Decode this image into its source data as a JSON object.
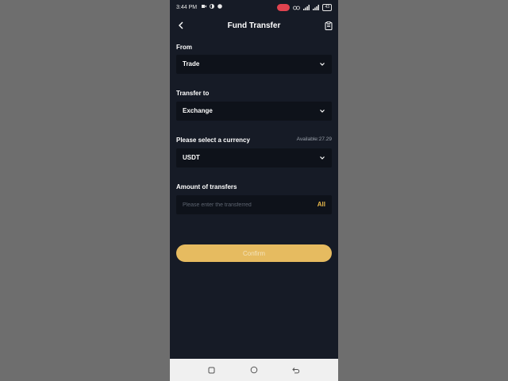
{
  "status_bar": {
    "time": "3:44 PM",
    "battery": "43"
  },
  "header": {
    "title": "Fund Transfer",
    "back_icon": "chevron-left-icon",
    "record_icon": "clipboard-icon"
  },
  "form": {
    "from_label": "From",
    "from_value": "Trade",
    "to_label": "Transfer to",
    "to_value": "Exchange",
    "currency_label": "Please select a currency",
    "available": "Available:27.29",
    "currency_value": "USDT",
    "amount_label": "Amount of transfers",
    "amount_value": "",
    "amount_placeholder": "Please enter the transferred",
    "all_label": "All"
  },
  "confirm_label": "Confirm",
  "colors": {
    "background": "#161b26",
    "field": "#0e121a",
    "accent": "#e6bb60",
    "all_text": "#e8b84a"
  },
  "nav": {
    "recent_icon": "square-icon",
    "home_icon": "circle-icon",
    "back_icon": "back-arrow-icon"
  }
}
